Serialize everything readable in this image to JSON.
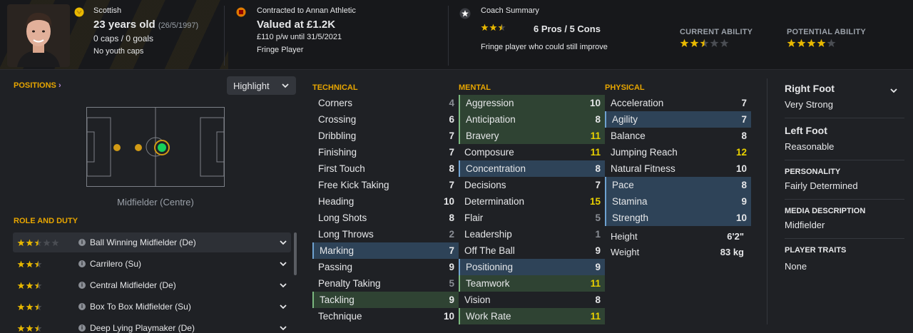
{
  "header": {
    "nationality": "Scottish",
    "age": "23 years old",
    "dob": "(26/5/1997)",
    "caps": "0 caps / 0 goals",
    "youth_caps": "No youth caps",
    "contract": "Contracted to Annan Athletic",
    "value": "Valued at £1.2K",
    "wage": "£110 p/w until 31/5/2021",
    "status": "Fringe Player",
    "coach_title": "Coach Summary",
    "coach_rating_stars": 2.5,
    "pros_cons": "6 Pros / 5 Cons",
    "coach_summary": "Fringe player who could still improve",
    "current_ability_label": "CURRENT ABILITY",
    "current_ability_stars": 2.5,
    "potential_ability_label": "POTENTIAL ABILITY",
    "potential_ability_stars": 4
  },
  "positions": {
    "title": "POSITIONS",
    "highlight_button": "Highlight",
    "position_label": "Midfielder (Centre)"
  },
  "roles": {
    "title": "ROLE AND DUTY",
    "items": [
      {
        "label": "Ball Winning Midfielder (De)",
        "stars": 2.5
      },
      {
        "label": "Carrilero (Su)",
        "stars": 2.5
      },
      {
        "label": "Central Midfielder (De)",
        "stars": 2.5
      },
      {
        "label": "Box To Box Midfielder (Su)",
        "stars": 2.5
      },
      {
        "label": "Deep Lying Playmaker (De)",
        "stars": 2.5
      }
    ]
  },
  "technical": {
    "title": "TECHNICAL",
    "rows": [
      {
        "name": "Corners",
        "value": "4"
      },
      {
        "name": "Crossing",
        "value": "6"
      },
      {
        "name": "Dribbling",
        "value": "7"
      },
      {
        "name": "Finishing",
        "value": "7"
      },
      {
        "name": "First Touch",
        "value": "8"
      },
      {
        "name": "Free Kick Taking",
        "value": "7"
      },
      {
        "name": "Heading",
        "value": "10"
      },
      {
        "name": "Long Shots",
        "value": "8"
      },
      {
        "name": "Long Throws",
        "value": "2"
      },
      {
        "name": "Marking",
        "value": "7"
      },
      {
        "name": "Passing",
        "value": "9"
      },
      {
        "name": "Penalty Taking",
        "value": "5"
      },
      {
        "name": "Tackling",
        "value": "9"
      },
      {
        "name": "Technique",
        "value": "10"
      }
    ]
  },
  "mental": {
    "title": "MENTAL",
    "rows": [
      {
        "name": "Aggression",
        "value": "10"
      },
      {
        "name": "Anticipation",
        "value": "8"
      },
      {
        "name": "Bravery",
        "value": "11"
      },
      {
        "name": "Composure",
        "value": "11"
      },
      {
        "name": "Concentration",
        "value": "8"
      },
      {
        "name": "Decisions",
        "value": "7"
      },
      {
        "name": "Determination",
        "value": "15"
      },
      {
        "name": "Flair",
        "value": "5"
      },
      {
        "name": "Leadership",
        "value": "1"
      },
      {
        "name": "Off The Ball",
        "value": "9"
      },
      {
        "name": "Positioning",
        "value": "9"
      },
      {
        "name": "Teamwork",
        "value": "11"
      },
      {
        "name": "Vision",
        "value": "8"
      },
      {
        "name": "Work Rate",
        "value": "11"
      }
    ]
  },
  "physical": {
    "title": "PHYSICAL",
    "rows": [
      {
        "name": "Acceleration",
        "value": "7"
      },
      {
        "name": "Agility",
        "value": "7"
      },
      {
        "name": "Balance",
        "value": "8"
      },
      {
        "name": "Jumping Reach",
        "value": "12"
      },
      {
        "name": "Natural Fitness",
        "value": "10"
      },
      {
        "name": "Pace",
        "value": "8"
      },
      {
        "name": "Stamina",
        "value": "9"
      },
      {
        "name": "Strength",
        "value": "10"
      }
    ],
    "height_label": "Height",
    "height": "6'2\"",
    "weight_label": "Weight",
    "weight": "83 kg"
  },
  "right_panel": {
    "right_foot_label": "Right Foot",
    "right_foot": "Very Strong",
    "left_foot_label": "Left Foot",
    "left_foot": "Reasonable",
    "personality_label": "PERSONALITY",
    "personality": "Fairly Determined",
    "media_label": "MEDIA DESCRIPTION",
    "media": "Midfielder",
    "traits_label": "PLAYER TRAITS",
    "traits": "None"
  },
  "colors": {
    "accent": "#e8a600",
    "star": "#e8b800",
    "highlight_blue": "#2e4358",
    "highlight_green": "#2f4333"
  }
}
